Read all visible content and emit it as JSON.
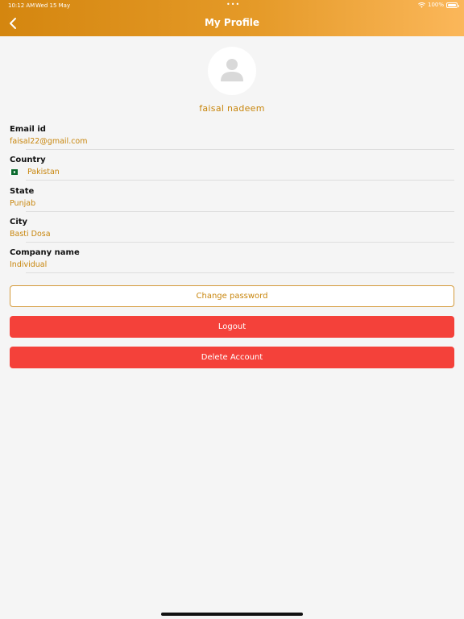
{
  "status_bar": {
    "time": "10:12 AM",
    "date": "Wed 15 May",
    "multitask_dots": "•••",
    "battery": "100%"
  },
  "header": {
    "title": "My Profile",
    "back_icon": "chevron-left-icon"
  },
  "profile": {
    "avatar_icon": "person-icon",
    "name": "faisal nadeem"
  },
  "fields": [
    {
      "label": "Email id",
      "value": "faisal22@gmail.com"
    },
    {
      "label": "Country",
      "value": "Pakistan",
      "icon": "pakistan-flag-icon"
    },
    {
      "label": "State",
      "value": "Punjab"
    },
    {
      "label": "City",
      "value": "Basti Dosa"
    },
    {
      "label": "Company name",
      "value": "Individual"
    }
  ],
  "buttons": {
    "change_password": "Change password",
    "logout": "Logout",
    "delete_account": "Delete Account"
  },
  "colors": {
    "accent": "#c8860d",
    "header_start": "#d4860f",
    "header_end": "#fbb75a",
    "danger": "#f4413a",
    "background": "#f5f5f5"
  }
}
